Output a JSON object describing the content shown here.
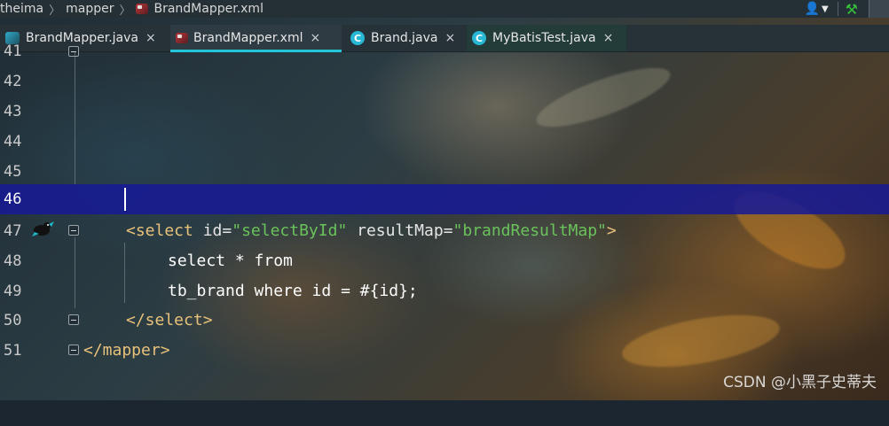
{
  "breadcrumb": [
    "theima",
    "mapper",
    "BrandMapper.xml"
  ],
  "tabs": [
    {
      "label": "BrandMapper.java",
      "icon": "java-interface-icon",
      "active": false
    },
    {
      "label": "BrandMapper.xml",
      "icon": "xml-icon",
      "active": true
    },
    {
      "label": "Brand.java",
      "icon": "class-icon",
      "active": false
    },
    {
      "label": "MyBatisTest.java",
      "icon": "class-icon",
      "active": false
    }
  ],
  "tab_close_glyph": "×",
  "class_icon_letter": "C",
  "editor": {
    "line_numbers": [
      "41",
      "42",
      "43",
      "44",
      "45",
      "46",
      "47",
      "48",
      "49",
      "50",
      "51"
    ],
    "current_line": "46",
    "code": {
      "l47_open": "<select ",
      "l47_attr1": "id",
      "l47_eq1": "=",
      "l47_val1": "\"selectById\"",
      "l47_attr2": " resultMap",
      "l47_eq2": "=",
      "l47_val2": "\"brandResultMap\"",
      "l47_close": ">",
      "l48": "select * from",
      "l49": "tb_brand where id = #{id};",
      "l50": "</select>",
      "l51": "</mapper>"
    }
  },
  "watermark": "CSDN @小黑子史蒂夫",
  "colors": {
    "tag": "#e8c17a",
    "attr_value": "#6ac35a",
    "current_line": "#16198f",
    "active_tab_underline": "#22c6d6"
  }
}
